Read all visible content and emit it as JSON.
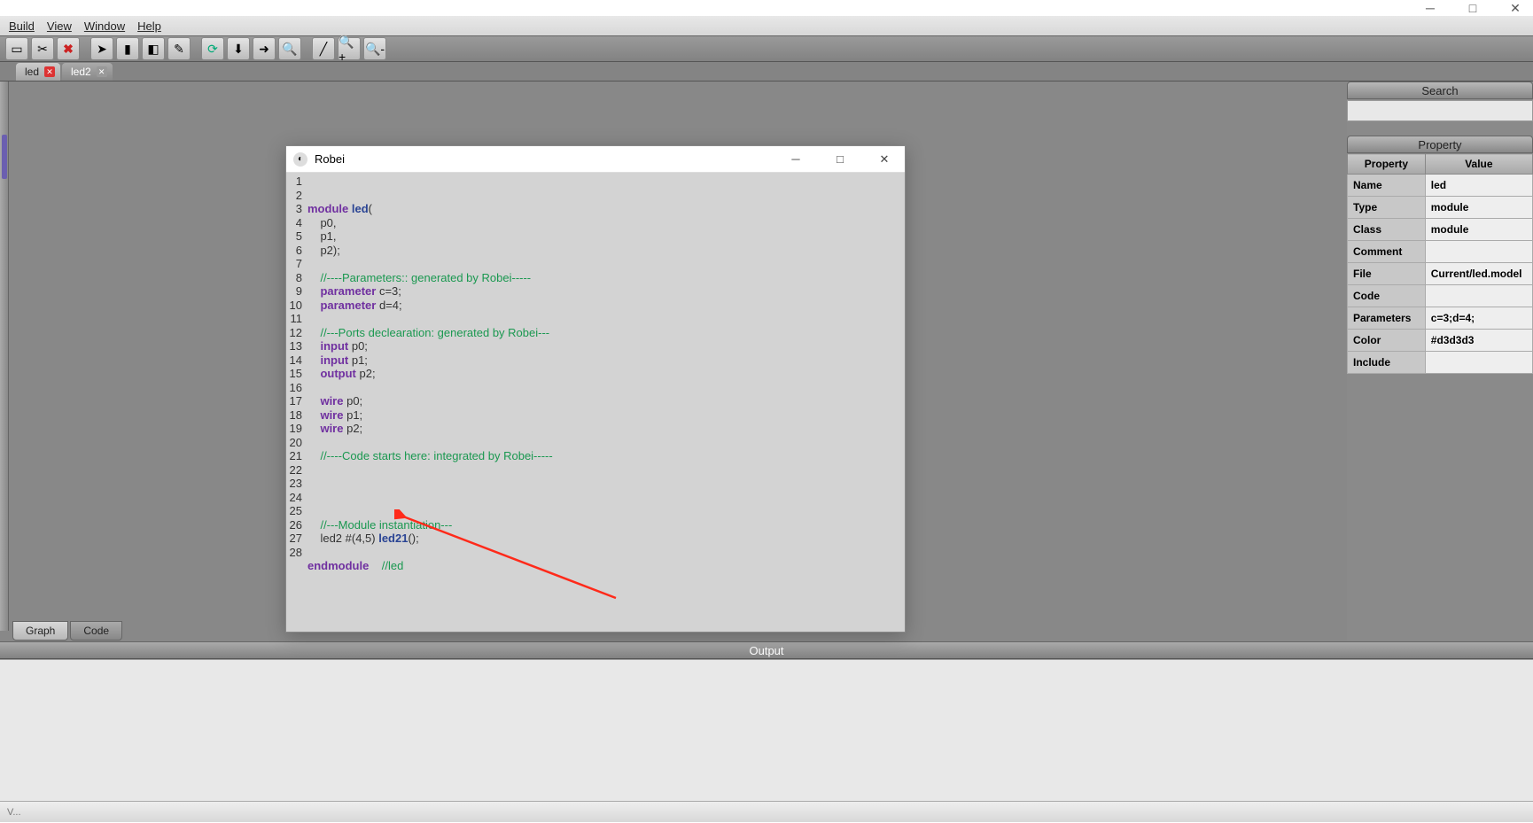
{
  "window_controls": {
    "min": "─",
    "max": "□",
    "close": "✕"
  },
  "menus": {
    "build": "Build",
    "view": "View",
    "window": "Window",
    "help": "Help"
  },
  "tabs": [
    {
      "label": "led",
      "close_style": "red",
      "active": true
    },
    {
      "label": "led2",
      "close_style": "gray",
      "active": false
    }
  ],
  "bottom_tabs": {
    "graph": "Graph",
    "code": "Code"
  },
  "output_label": "Output",
  "status": "V...",
  "right": {
    "search": "Search",
    "property": "Property",
    "headers": {
      "prop": "Property",
      "val": "Value"
    },
    "rows": [
      {
        "k": "Name",
        "v": "led"
      },
      {
        "k": "Type",
        "v": "module"
      },
      {
        "k": "Class",
        "v": "module"
      },
      {
        "k": "Comment",
        "v": ""
      },
      {
        "k": "File",
        "v": "Current/led.model"
      },
      {
        "k": "Code",
        "v": ""
      },
      {
        "k": "Parameters",
        "v": "c=3;d=4;"
      },
      {
        "k": "Color",
        "v": "#d3d3d3"
      },
      {
        "k": "Include",
        "v": ""
      }
    ]
  },
  "code_window": {
    "title": "Robei",
    "lines": [
      {
        "n": 1,
        "html": "<span class='kw'>module</span> <span class='id'>led</span><span class='txt'>(</span>"
      },
      {
        "n": 2,
        "html": "    <span class='txt'>p0,</span>"
      },
      {
        "n": 3,
        "html": "    <span class='txt'>p1,</span>"
      },
      {
        "n": 4,
        "html": "    <span class='txt'>p2);</span>"
      },
      {
        "n": 5,
        "html": ""
      },
      {
        "n": 6,
        "html": "    <span class='cm'>//----Parameters:: generated by Robei-----</span>"
      },
      {
        "n": 7,
        "html": "    <span class='kw'>parameter</span> <span class='txt'>c=3;</span>"
      },
      {
        "n": 8,
        "html": "    <span class='kw'>parameter</span> <span class='txt'>d=4;</span>"
      },
      {
        "n": 9,
        "html": ""
      },
      {
        "n": 10,
        "html": "    <span class='cm'>//---Ports declearation: generated by Robei---</span>"
      },
      {
        "n": 11,
        "html": "    <span class='kw'>input</span> <span class='txt'>p0;</span>"
      },
      {
        "n": 12,
        "html": "    <span class='kw'>input</span> <span class='txt'>p1;</span>"
      },
      {
        "n": 13,
        "html": "    <span class='kw'>output</span> <span class='txt'>p2;</span>"
      },
      {
        "n": 14,
        "html": ""
      },
      {
        "n": 15,
        "html": "    <span class='kw'>wire</span> <span class='txt'>p0;</span>"
      },
      {
        "n": 16,
        "html": "    <span class='kw'>wire</span> <span class='txt'>p1;</span>"
      },
      {
        "n": 17,
        "html": "    <span class='kw'>wire</span> <span class='txt'>p2;</span>"
      },
      {
        "n": 18,
        "html": ""
      },
      {
        "n": 19,
        "html": "    <span class='cm'>//----Code starts here: integrated by Robei-----</span>"
      },
      {
        "n": 20,
        "html": ""
      },
      {
        "n": 21,
        "html": ""
      },
      {
        "n": 22,
        "html": ""
      },
      {
        "n": 23,
        "html": ""
      },
      {
        "n": 24,
        "html": "    <span class='cm'>//---Module instantiation---</span>"
      },
      {
        "n": 25,
        "html": "    <span class='txt'>led2 #(4,5) </span><span class='id'>led21</span><span class='txt'>();</span>"
      },
      {
        "n": 26,
        "html": ""
      },
      {
        "n": 27,
        "html": "<span class='kw'>endmodule</span>    <span class='cm'>//led</span>"
      },
      {
        "n": 28,
        "html": ""
      }
    ]
  }
}
